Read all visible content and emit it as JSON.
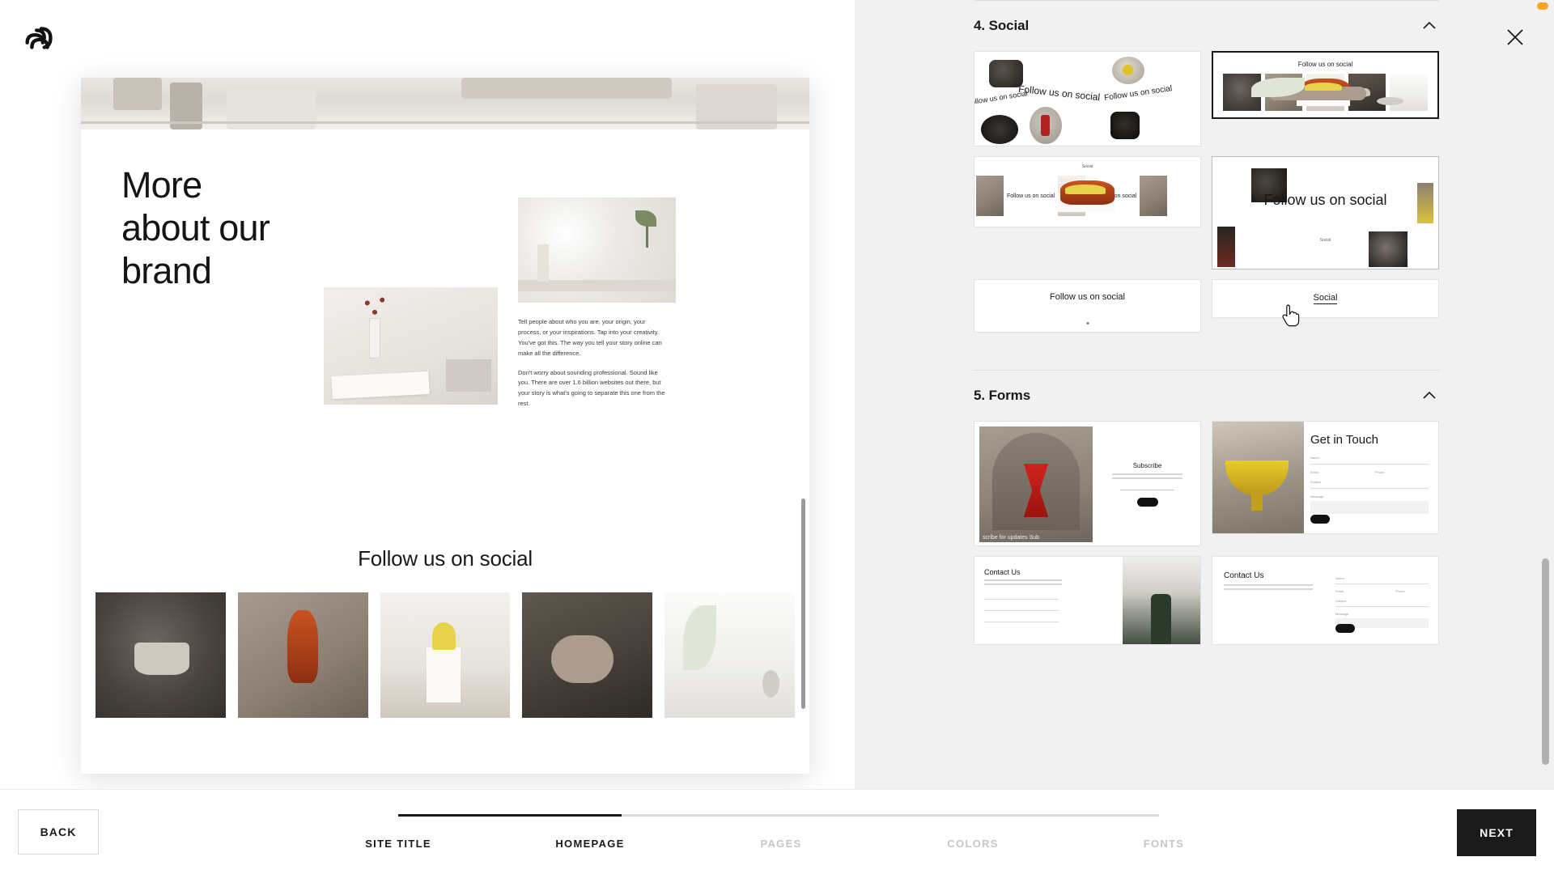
{
  "app": {
    "logo_name": "squarespace-logo",
    "close_label": "×"
  },
  "preview": {
    "heading_line1": "More",
    "heading_line2": "about our",
    "heading_line3": "brand",
    "paragraph1": "Tell people about who you are, your origin, your process, or your inspirations. Tap into your creativity. You've got this. The way you tell your story online can make all the difference.",
    "paragraph2": "Don't worry about sounding professional. Sound like you. There are over 1.6 billion websites out there, but your story is what's going to separate this one from the rest.",
    "social_heading": "Follow us on social"
  },
  "panel": {
    "sections": [
      {
        "id": "social",
        "title": "4. Social",
        "collapse_icon": "chevron-up-icon",
        "cards": [
          {
            "id": "social-scattered",
            "text": "Follow us on social",
            "state": "default"
          },
          {
            "id": "social-row-selected",
            "text": "Follow us on social",
            "state": "selected"
          },
          {
            "id": "social-carousel",
            "text": "Follow us on social",
            "label": "Social",
            "state": "default"
          },
          {
            "id": "social-centered-large",
            "text": "Follow us on social",
            "label": "Social",
            "state": "hovered"
          },
          {
            "id": "social-text-only",
            "text": "Follow us on social",
            "state": "default"
          },
          {
            "id": "social-link",
            "text": "Social",
            "state": "default"
          }
        ]
      },
      {
        "id": "forms",
        "title": "5. Forms",
        "collapse_icon": "chevron-up-icon",
        "cards": [
          {
            "id": "form-subscribe",
            "title": "Subscribe",
            "caption": "scribe for updates      Sub",
            "state": "default"
          },
          {
            "id": "form-get-in-touch",
            "title": "Get in Touch",
            "fields": [
              "Name",
              "Email",
              "Phone",
              "Subject",
              "Message"
            ],
            "state": "default"
          },
          {
            "id": "form-contact-us-right",
            "title": "Contact Us",
            "fields": [
              "Name",
              "Email",
              "Phone",
              "Subject",
              "Message"
            ],
            "state": "default"
          },
          {
            "id": "form-contact-us-image",
            "title": "Contact Us",
            "state": "default"
          }
        ]
      }
    ]
  },
  "bottom": {
    "back_label": "BACK",
    "next_label": "NEXT",
    "progress_percent": 29,
    "steps": [
      {
        "label": "SITE TITLE",
        "state": "done"
      },
      {
        "label": "HOMEPAGE",
        "state": "current"
      },
      {
        "label": "PAGES",
        "state": "todo"
      },
      {
        "label": "COLORS",
        "state": "todo"
      },
      {
        "label": "FONTS",
        "state": "todo"
      }
    ]
  },
  "colors": {
    "accent": "#1a1a1a",
    "panel_bg": "#f1f1f1",
    "inactive_text": "#c6c6c6",
    "scroll_marker": "#f5a623"
  }
}
